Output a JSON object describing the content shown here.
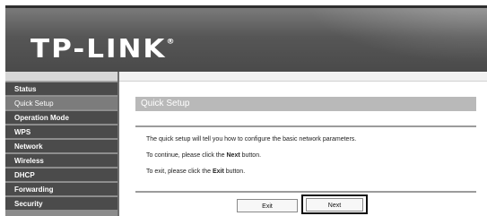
{
  "app": {
    "logo_text": "TP-LINK",
    "logo_mark": "®"
  },
  "sidebar": {
    "items": [
      {
        "label": "Status"
      },
      {
        "label": "Quick Setup"
      },
      {
        "label": "Operation Mode"
      },
      {
        "label": "WPS"
      },
      {
        "label": "Network"
      },
      {
        "label": "Wireless"
      },
      {
        "label": "DHCP"
      },
      {
        "label": "Forwarding"
      },
      {
        "label": "Security"
      }
    ],
    "active": "Quick Setup"
  },
  "page": {
    "title": "Quick Setup",
    "line1": "The quick setup will tell you how to configure the basic network parameters.",
    "line2_prefix": "To continue, please click the ",
    "line2_bold": "Next",
    "line2_suffix": " button.",
    "line3_prefix": "To exit, please click the ",
    "line3_bold": "Exit",
    "line3_suffix": " button."
  },
  "buttons": {
    "exit_label": "Exit",
    "next_label": "Next"
  },
  "colors": {
    "header_bg": "#565656",
    "nav_bg": "#4b4b4b",
    "nav_active_bg": "#7c7c7c",
    "section_bar_bg": "#b9b9b9"
  }
}
